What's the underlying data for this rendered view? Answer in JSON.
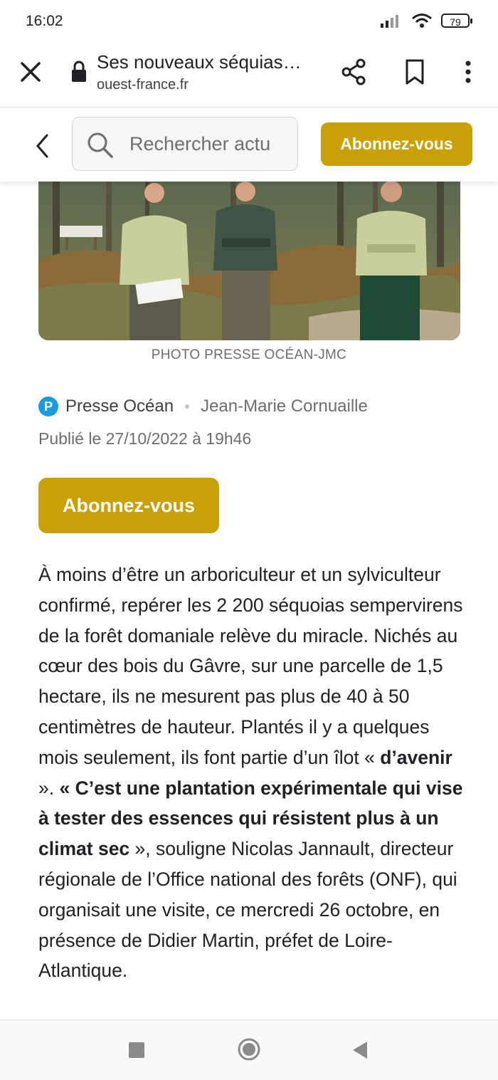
{
  "status": {
    "time": "16:02",
    "battery": "79"
  },
  "browser": {
    "title": "Ses nouveaux séquias…",
    "domain": "ouest-france.fr"
  },
  "header": {
    "search_placeholder": "Rechercher actu",
    "subscribe_label": "Abonnez-vous"
  },
  "photo": {
    "caption": "PHOTO PRESSE OCÉAN-JMC"
  },
  "meta": {
    "source_initial": "P",
    "source": "Presse Océan",
    "author": "Jean-Marie Cornuaille",
    "published": "Publié le 27/10/2022 à 19h46"
  },
  "subscribe_button": "Abonnez-vous",
  "article": {
    "p1_a": "À moins d’être un arboriculteur et un sylviculteur confirmé, repérer les 2 200 séquoias sempervirens de la forêt domaniale relève du miracle. Nichés au cœur des bois du Gâvre, sur une parcelle de 1,5 hectare, ils ne mesurent pas plus de 40 à 50 centimètres de hauteur. Plantés il y a quelques mois seulement, ils font partie d’un îlot « ",
    "p1_b": "d’avenir",
    "p1_c": " ». ",
    "p1_d": "« C’est une plantation expérimentale qui vise à tester des essences qui résistent plus à un climat sec",
    "p1_e": " », souligne Nicolas Jannault, directeur régionale de l’Office national des forêts (ONF), qui organisait une visite, ce mercredi 26 octobre, en présence de Didier Martin, préfet de Loire-Atlantique."
  },
  "colors": {
    "accent": "#c9a005",
    "source_logo": "#1a9be0"
  }
}
